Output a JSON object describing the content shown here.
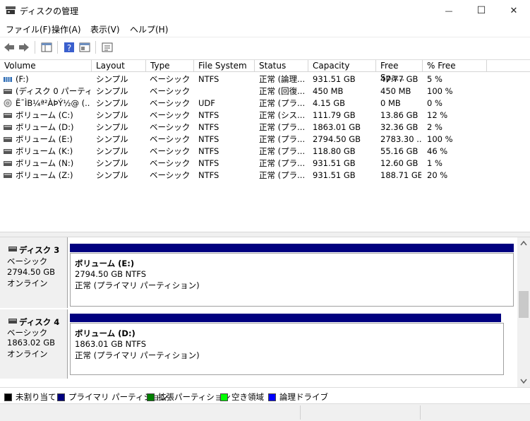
{
  "window": {
    "title": "ディスクの管理",
    "minimize_glyph": "—",
    "maximize_glyph": "☐",
    "close_glyph": "✕"
  },
  "menu": [
    "ファイル(F)",
    "操作(A)",
    "表示(V)",
    "ヘルプ(H)"
  ],
  "columns": [
    "Volume",
    "Layout",
    "Type",
    "File System",
    "Status",
    "Capacity",
    "Free Spa...",
    "% Free"
  ],
  "volumes": [
    {
      "volume": "(F:)",
      "layout": "シンプル",
      "type": "ベーシック",
      "fs": "NTFS",
      "status": "正常 (論理...",
      "capacity": "931.51 GB",
      "free": "47.77 GB",
      "pct": "5 %",
      "icon": "striped-drive-icon"
    },
    {
      "volume": "(ディスク 0 パーティシ...",
      "layout": "シンプル",
      "type": "ベーシック",
      "fs": "",
      "status": "正常 (回復...",
      "capacity": "450 MB",
      "free": "450 MB",
      "pct": "100 %",
      "icon": "drive-icon"
    },
    {
      "volume": "Ë¯ÌB¼ª²ÀÞÝ½@ (...",
      "layout": "シンプル",
      "type": "ベーシック",
      "fs": "UDF",
      "status": "正常 (プラ...",
      "capacity": "4.15 GB",
      "free": "0 MB",
      "pct": "0 %",
      "icon": "optical-drive-icon"
    },
    {
      "volume": "ボリューム (C:)",
      "layout": "シンプル",
      "type": "ベーシック",
      "fs": "NTFS",
      "status": "正常 (シス...",
      "capacity": "111.79 GB",
      "free": "13.86 GB",
      "pct": "12 %",
      "icon": "drive-icon"
    },
    {
      "volume": "ボリューム (D:)",
      "layout": "シンプル",
      "type": "ベーシック",
      "fs": "NTFS",
      "status": "正常 (プラ...",
      "capacity": "1863.01 GB",
      "free": "32.36 GB",
      "pct": "2 %",
      "icon": "drive-icon"
    },
    {
      "volume": "ボリューム (E:)",
      "layout": "シンプル",
      "type": "ベーシック",
      "fs": "NTFS",
      "status": "正常 (プラ...",
      "capacity": "2794.50 GB",
      "free": "2783.30 ...",
      "pct": "100 %",
      "icon": "drive-icon"
    },
    {
      "volume": "ボリューム (K:)",
      "layout": "シンプル",
      "type": "ベーシック",
      "fs": "NTFS",
      "status": "正常 (プラ...",
      "capacity": "118.80 GB",
      "free": "55.16 GB",
      "pct": "46 %",
      "icon": "drive-icon"
    },
    {
      "volume": "ボリューム (N:)",
      "layout": "シンプル",
      "type": "ベーシック",
      "fs": "NTFS",
      "status": "正常 (プラ...",
      "capacity": "931.51 GB",
      "free": "12.60 GB",
      "pct": "1 %",
      "icon": "drive-icon"
    },
    {
      "volume": "ボリューム (Z:)",
      "layout": "シンプル",
      "type": "ベーシック",
      "fs": "NTFS",
      "status": "正常 (プラ...",
      "capacity": "931.51 GB",
      "free": "188.71 GB",
      "pct": "20 %",
      "icon": "drive-icon"
    }
  ],
  "disks": [
    {
      "name": "ディスク 3",
      "type": "ベーシック",
      "size": "2794.50 GB",
      "state": "オンライン",
      "partition": {
        "name": "ボリューム  (E:)",
        "size_fs": "2794.50 GB NTFS",
        "status": "正常 (プライマリ パーティション)"
      }
    },
    {
      "name": "ディスク 4",
      "type": "ベーシック",
      "size": "1863.02 GB",
      "state": "オンライン",
      "partition": {
        "name": "ボリューム  (D:)",
        "size_fs": "1863.01 GB NTFS",
        "status": "正常 (プライマリ パーティション)"
      }
    }
  ],
  "legend": [
    {
      "label": "未割り当て",
      "color": "#000000"
    },
    {
      "label": "プライマリ パーティション",
      "color": "#00007f"
    },
    {
      "label": "拡張パーティション",
      "color": "#007f00"
    },
    {
      "label": "空き領域",
      "color": "#00ff00"
    },
    {
      "label": "論理ドライブ",
      "color": "#0000ff"
    }
  ],
  "colors": {
    "primary_partition": "#00007f",
    "accent": "#0078d7"
  }
}
